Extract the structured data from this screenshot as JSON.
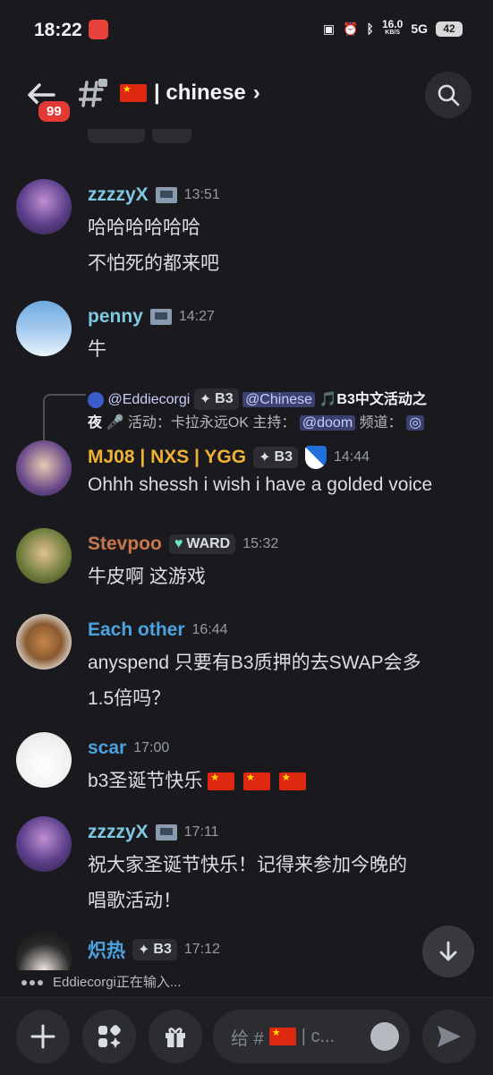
{
  "status": {
    "time": "18:22",
    "speed": "16.0",
    "speed_unit": "KB/S",
    "net": "5G",
    "battery": "42"
  },
  "header": {
    "badge": "99",
    "channel_name": "| chinese",
    "chevron": "›"
  },
  "messages": [
    {
      "user": "zzzzyX",
      "time": "13:51",
      "lines": [
        "哈哈哈哈哈哈",
        "不怕死的都来吧"
      ],
      "color": "#7ec8e3"
    },
    {
      "user": "penny",
      "time": "14:27",
      "lines": [
        "牛"
      ],
      "color": "#7ec8e3"
    },
    {
      "reply": {
        "user": "@Eddiecorgi",
        "tag": "B3",
        "mention1": "@Chinese",
        "text1": "🎵B3中文活动之",
        "text2": "夜",
        "text3": "活动：卡拉永远OK 主持：",
        "mention2": "@doom",
        "text4": "频道："
      },
      "user": "MJ08 | NXS | YGG",
      "tag": "B3",
      "time": "14:44",
      "lines": [
        "Ohhh shessh i wish i have a golded voice"
      ],
      "color": "#f0b232"
    },
    {
      "user": "Stevpoo",
      "tag": "WARD",
      "time": "15:32",
      "lines": [
        "牛皮啊 这游戏"
      ],
      "color": "#c9774a"
    },
    {
      "user": "Each other",
      "time": "16:44",
      "lines": [
        "anyspend  只要有B3质押的去SWAP会多",
        "1.5倍吗？"
      ],
      "color": "#4aa3df"
    },
    {
      "user": "scar",
      "time": "17:00",
      "lines": [
        "b3圣诞节快乐"
      ],
      "color": "#4aa3df"
    },
    {
      "user": "zzzzyX",
      "time": "17:11",
      "lines": [
        "祝大家圣诞节快乐！记得来参加今晚的",
        "唱歌活动！"
      ],
      "color": "#7ec8e3"
    },
    {
      "user": "炽热",
      "tag": "B3",
      "time": "17:12",
      "color": "#4aa3df"
    }
  ],
  "typing": "Eddiecorgi正在输入...",
  "composer": {
    "placeholder_prefix": "给 #",
    "placeholder_suffix": "| c..."
  },
  "icons": [
    "back-arrow-icon",
    "text-channel-icon",
    "search-icon",
    "plus-icon",
    "apps-icon",
    "gift-icon",
    "emoji-icon",
    "send-icon",
    "arrow-down-icon"
  ]
}
